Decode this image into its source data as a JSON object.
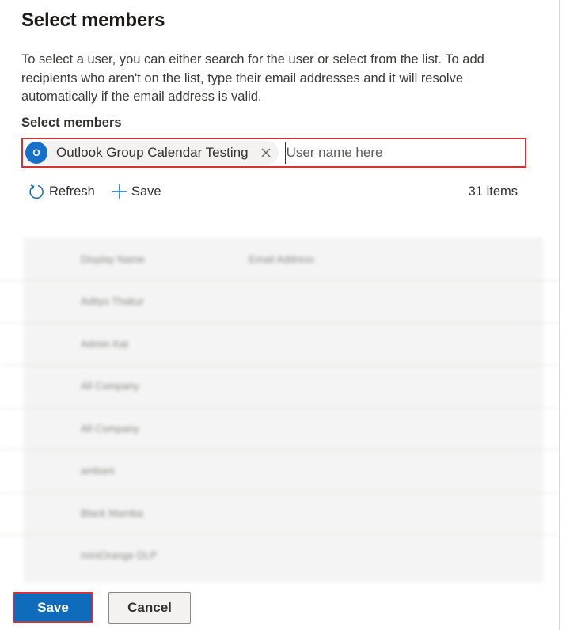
{
  "panel": {
    "title": "Select members",
    "description": "To select a user, you can either search for the user or select from the list. To add recipients who aren't on the list, type their email addresses and it will resolve automatically if the email address is valid."
  },
  "picker": {
    "label": "Select members",
    "selected": [
      {
        "initial": "O",
        "label": "Outlook Group Calendar Testing",
        "avatar_color": "#1570c7"
      }
    ],
    "placeholder": "User name here",
    "value": ""
  },
  "toolbar": {
    "refresh_label": "Refresh",
    "save_label": "Save",
    "items_count": "31 items"
  },
  "list": {
    "columns": [
      "Display Name",
      "Email Address"
    ],
    "rows": [
      "Adityo Thakur",
      "Admin Kat",
      "All Company",
      "All Company",
      "ambani",
      "Black Mamba",
      "miniOrange DLP"
    ]
  },
  "footer": {
    "save_label": "Save",
    "cancel_label": "Cancel"
  },
  "colors": {
    "accent": "#0f6cbd",
    "highlight_border": "#d13438"
  }
}
